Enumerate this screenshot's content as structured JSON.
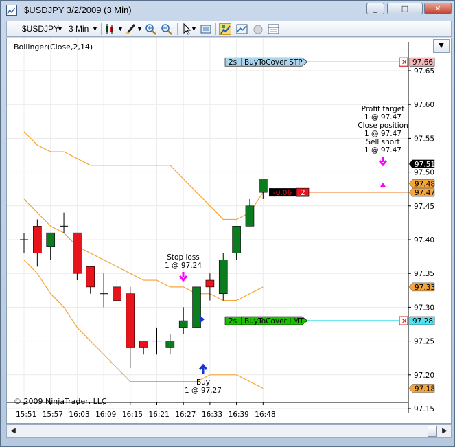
{
  "window": {
    "title": "$USDJPY  3/2/2009 (3 Min)",
    "controls": {
      "minimize": "_",
      "maximize": "□",
      "close": "✕"
    }
  },
  "toolbar": {
    "instrument": "$USDJPY",
    "interval": "3 Min",
    "icons": [
      "candlestick-style-icon",
      "draw-tool-icon",
      "zoom-in-icon",
      "zoom-out-icon",
      "cursor-icon",
      "snapshot-icon",
      "chart-trader-icon",
      "indicators-icon",
      "strategy-icon",
      "data-box-icon"
    ]
  },
  "chart": {
    "indicator_label": "Bollinger(Close,2,14)",
    "copyright": "© 2009 NinjaTrader, LLC",
    "price_ticks": [
      "97.65",
      "97.60",
      "97.55",
      "97.50",
      "97.45",
      "97.40",
      "97.35",
      "97.30",
      "97.25",
      "97.20",
      "97.15"
    ],
    "time_ticks": [
      "15:51",
      "15:57",
      "16:03",
      "16:09",
      "16:15",
      "16:21",
      "16:27",
      "16:33",
      "16:39",
      "16:48"
    ],
    "orders": {
      "stop": {
        "qty": "2s",
        "label": "BuyToCover STP",
        "price": "97.66",
        "color": "#a9d4ec"
      },
      "limit": {
        "qty": "2s",
        "label": "BuyToCover LMT",
        "price": "97.28",
        "color": "#19c000"
      },
      "position": {
        "pnl": "-0.06",
        "qty": "2",
        "price": "97.47"
      }
    },
    "price_badges": [
      {
        "text": "97.51",
        "bg": "#000000",
        "fg": "#ffffff"
      },
      {
        "text": "97.48",
        "bg": "#f4a63a",
        "fg": "#000000"
      },
      {
        "text": "97.47",
        "bg": "#f4a63a",
        "fg": "#000000"
      },
      {
        "text": "97.33",
        "bg": "#f4a63a",
        "fg": "#000000"
      },
      {
        "text": "97.18",
        "bg": "#f4a63a",
        "fg": "#000000"
      }
    ],
    "annotations": {
      "stop_loss": [
        "Stop loss",
        "1 @ 97.24"
      ],
      "buy": [
        "Buy",
        "1 @ 97.27"
      ],
      "exit": [
        "Profit target",
        "1 @ 97.47",
        "Close position",
        "1 @ 97.47",
        "Sell short",
        "1 @ 97.47"
      ]
    },
    "colors": {
      "up": "#0b7d1f",
      "down": "#e8141c",
      "band": "#f3a535",
      "limit_line": "#19d8ee",
      "stop_line": "#f4a8a8",
      "pos_line": "#f4a06b"
    }
  },
  "chart_data": {
    "type": "candlestick",
    "x": [
      "15:51",
      "15:54",
      "15:57",
      "16:00",
      "16:03",
      "16:06",
      "16:09",
      "16:12",
      "16:15",
      "16:18",
      "16:21",
      "16:24",
      "16:27",
      "16:30",
      "16:33",
      "16:36",
      "16:39",
      "16:42",
      "16:45"
    ],
    "ohlc": [
      [
        97.4,
        97.41,
        97.38,
        97.4
      ],
      [
        97.42,
        97.43,
        97.36,
        97.38
      ],
      [
        97.39,
        97.41,
        97.37,
        97.41
      ],
      [
        97.42,
        97.44,
        97.41,
        97.42
      ],
      [
        97.41,
        97.41,
        97.34,
        97.35
      ],
      [
        97.36,
        97.36,
        97.32,
        97.33
      ],
      [
        97.32,
        97.35,
        97.3,
        97.32
      ],
      [
        97.33,
        97.34,
        97.31,
        97.31
      ],
      [
        97.32,
        97.33,
        97.21,
        97.24
      ],
      [
        97.25,
        97.25,
        97.23,
        97.24
      ],
      [
        97.25,
        97.27,
        97.23,
        97.25
      ],
      [
        97.24,
        97.26,
        97.23,
        97.25
      ],
      [
        97.27,
        97.3,
        97.26,
        97.28
      ],
      [
        97.27,
        97.33,
        97.27,
        97.33
      ],
      [
        97.34,
        97.35,
        97.31,
        97.33
      ],
      [
        97.32,
        97.38,
        97.31,
        97.37
      ],
      [
        97.38,
        97.42,
        97.37,
        97.42
      ],
      [
        97.42,
        97.46,
        97.42,
        97.45
      ],
      [
        97.47,
        97.49,
        97.46,
        97.49
      ]
    ],
    "bollinger": {
      "upper": [
        97.56,
        97.54,
        97.53,
        97.53,
        97.52,
        97.51,
        97.51,
        97.51,
        97.51,
        97.51,
        97.51,
        97.51,
        97.49,
        97.47,
        97.45,
        97.43,
        97.43,
        97.44,
        97.47
      ],
      "middle": [
        97.46,
        97.44,
        97.42,
        97.41,
        97.39,
        97.38,
        97.37,
        97.36,
        97.35,
        97.34,
        97.34,
        97.33,
        97.33,
        97.32,
        97.32,
        97.31,
        97.31,
        97.32,
        97.33
      ],
      "lower": [
        97.37,
        97.35,
        97.32,
        97.3,
        97.27,
        97.25,
        97.23,
        97.21,
        97.19,
        97.19,
        97.19,
        97.19,
        97.19,
        97.19,
        97.2,
        97.2,
        97.2,
        97.19,
        97.18
      ]
    },
    "ylim": [
      97.15,
      97.67
    ],
    "title": "",
    "xlabel": "",
    "ylabel": ""
  }
}
